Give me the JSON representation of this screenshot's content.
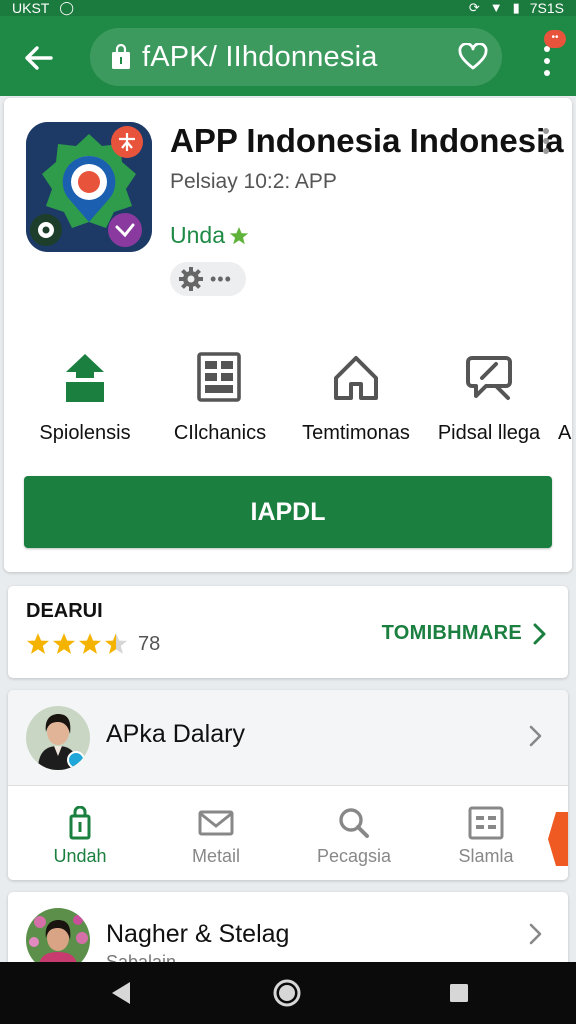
{
  "status_bar": {
    "left_text": "UKST",
    "time": "7S1S"
  },
  "app_bar": {
    "url_text": "fAPK/ IIhdonnesia",
    "notification_count": ""
  },
  "app": {
    "title": "APP Indonesia Indonesia",
    "subtitle": "Pelsiay 10:2: APP",
    "developer": "Unda",
    "icon_colors": {
      "bg": "#1d3a66",
      "gear": "#2e9c4a",
      "pin_outer": "#1b5fb0",
      "pin_inner": "#e8533c"
    }
  },
  "actions": [
    {
      "label": "Spiolensis",
      "icon": "upload-icon"
    },
    {
      "label": "CIlchanics",
      "icon": "grid-document-icon"
    },
    {
      "label": "Temtimonas",
      "icon": "house-icon"
    },
    {
      "label": "Pidsal llega",
      "icon": "chat-icon"
    }
  ],
  "actions_overflow": "A",
  "install": {
    "label": "IAPDL"
  },
  "rating": {
    "heading": "DEARUI",
    "stars": 3.5,
    "count": "78",
    "more_label": "TOMIBHMARE"
  },
  "profile": {
    "name": "APka Dalary"
  },
  "tabs": [
    {
      "label": "Undah",
      "icon": "bag-icon",
      "active": true
    },
    {
      "label": "Metail",
      "icon": "mail-icon",
      "active": false
    },
    {
      "label": "Pecagsia",
      "icon": "search-icon",
      "active": false
    },
    {
      "label": "Slamla",
      "icon": "list-icon",
      "active": false
    }
  ],
  "profile2": {
    "name": "Nagher & Stelag",
    "sub": "Sabalain"
  },
  "colors": {
    "accent": "#1e8a45",
    "button": "#1a7f3f",
    "star": "#f5b301"
  }
}
